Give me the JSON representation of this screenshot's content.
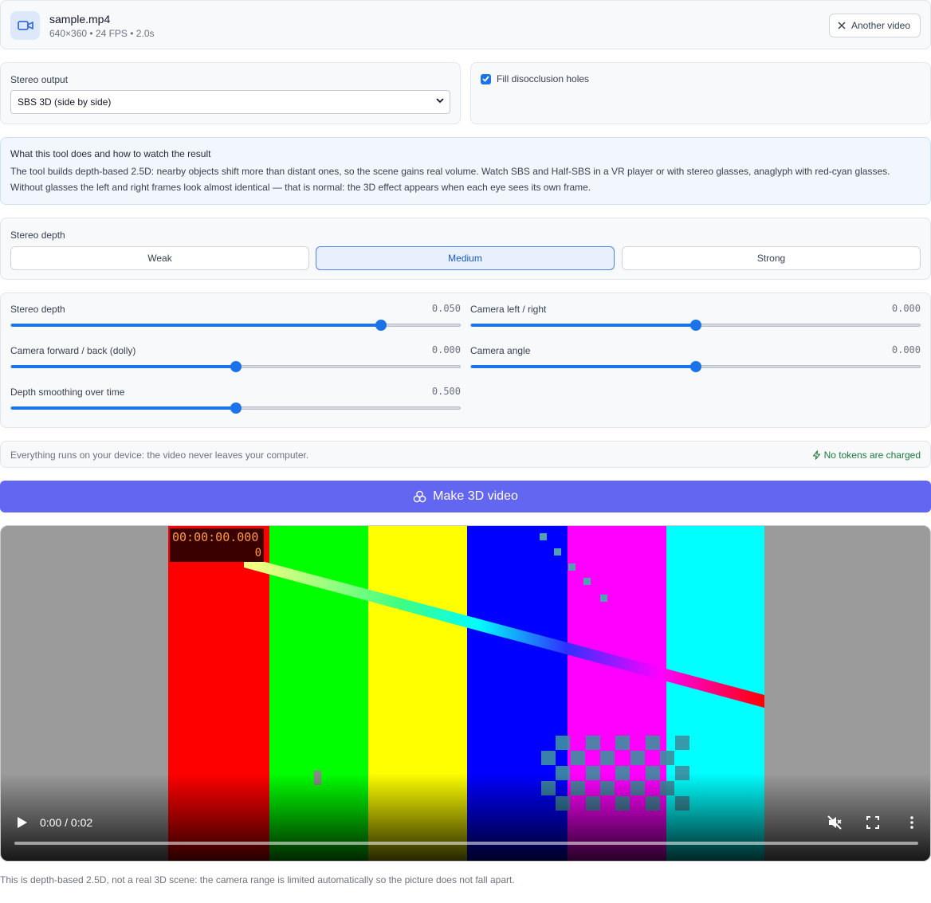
{
  "file": {
    "name": "sample.mp4",
    "meta": "640×360 • 24 FPS • 2.0s",
    "another_label": "Another video",
    "icon": "video-camera-icon"
  },
  "output": {
    "label": "Stereo output",
    "selected": "SBS 3D (side by side)"
  },
  "fill_holes": {
    "label": "Fill disocclusion holes",
    "checked": true
  },
  "info": {
    "title": "What this tool does and how to watch the result",
    "line1": "The tool builds depth-based 2.5D: nearby objects shift more than distant ones, so the scene gains real volume. Watch SBS and Half-SBS in a VR player or with stereo glasses, anaglyph with red-cyan glasses.",
    "line2": "Without glasses the left and right frames look almost identical — that is normal: the 3D effect appears when each eye sees its own frame."
  },
  "depth_preset": {
    "label": "Stereo depth",
    "options": [
      "Weak",
      "Medium",
      "Strong"
    ],
    "active": "Medium"
  },
  "sliders": [
    {
      "label": "Stereo depth",
      "value_text": "0.050",
      "fraction": 0.825
    },
    {
      "label": "Camera left / right",
      "value_text": "0.000",
      "fraction": 0.5
    },
    {
      "label": "Camera forward / back (dolly)",
      "value_text": "0.000",
      "fraction": 0.5
    },
    {
      "label": "Camera angle",
      "value_text": "0.000",
      "fraction": 0.5
    },
    {
      "label": "Depth smoothing over time",
      "value_text": "0.500",
      "fraction": 0.5
    }
  ],
  "privacy": {
    "text": "Everything runs on your device: the video never leaves your computer.",
    "tokens": "No tokens are charged",
    "tokens_color": "#1b7a3a"
  },
  "make_button": {
    "label": "Make 3D video",
    "color": "#6366f1"
  },
  "video": {
    "timecode": "00:00:00.000",
    "frame_number": "0",
    "time": "0:00 / 0:02",
    "playback_position": 0,
    "bar_colors": [
      "#ff0000",
      "#00ff00",
      "#ffff00",
      "#0000ff",
      "#ff00ff",
      "#00ffff"
    ]
  },
  "footnote": "This is depth-based 2.5D, not a real 3D scene: the camera range is limited automatically so the picture does not fall apart."
}
